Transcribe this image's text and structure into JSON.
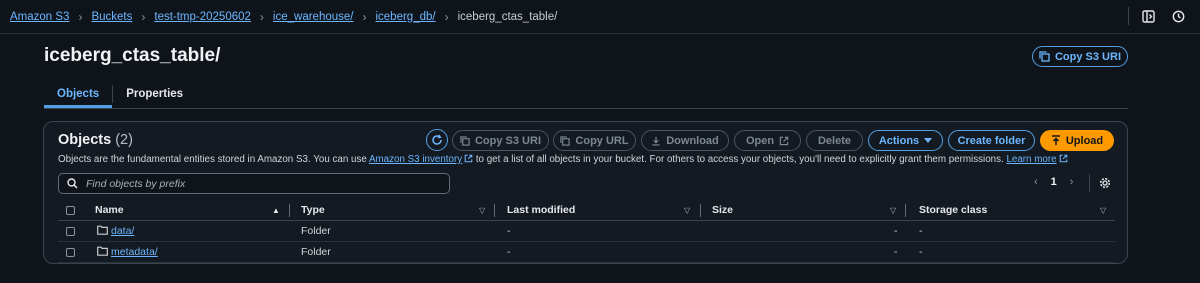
{
  "breadcrumb": {
    "items": [
      "Amazon S3",
      "Buckets",
      "test-tmp-20250602",
      "ice_warehouse/",
      "iceberg_db/"
    ],
    "current": "iceberg_ctas_table/"
  },
  "page": {
    "title": "iceberg_ctas_table/",
    "copy_uri_label": "Copy S3 URI"
  },
  "tabs": [
    {
      "label": "Objects",
      "active": true
    },
    {
      "label": "Properties",
      "active": false
    }
  ],
  "objects": {
    "title": "Objects",
    "count": "(2)",
    "description_pre": "Objects are the fundamental entities stored in Amazon S3. You can use ",
    "inventory_link": "Amazon S3 inventory",
    "description_mid": " to get a list of all objects in your bucket. For others to access your objects, you'll need to explicitly grant them permissions. ",
    "learn_more": "Learn more",
    "buttons": {
      "copy_s3_uri": "Copy S3 URI",
      "copy_url": "Copy URL",
      "download": "Download",
      "open": "Open",
      "delete": "Delete",
      "actions": "Actions",
      "create_folder": "Create folder",
      "upload": "Upload"
    },
    "search_placeholder": "Find objects by prefix",
    "page_number": "1",
    "columns": [
      "Name",
      "Type",
      "Last modified",
      "Size",
      "Storage class"
    ],
    "rows": [
      {
        "name": "data/",
        "type": "Folder",
        "last_modified": "-",
        "size": "-",
        "storage_class": "-"
      },
      {
        "name": "metadata/",
        "type": "Folder",
        "last_modified": "-",
        "size": "-",
        "storage_class": "-"
      }
    ]
  },
  "colors": {
    "accent": "#539fe5",
    "link": "#6cb6ff",
    "primary_button": "#ff9900",
    "background": "#0f141a"
  }
}
